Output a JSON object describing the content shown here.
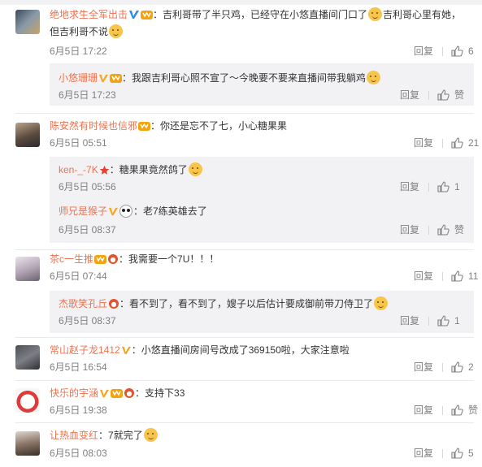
{
  "icons": {
    "like": "thumbs-up-icon",
    "verified": "verified-v-icon",
    "vip": "vip-crown-badge-icon",
    "star": "star-badge-icon",
    "emoji": "emoji-icon"
  },
  "colors": {
    "username": "#eb7350",
    "meta": "#808080",
    "subbox_bg": "#f2f2f5"
  },
  "comments": [
    {
      "user": "绝地求生全军出击",
      "text_line1": "：吉利哥带了半只鸡，已经守在小悠直播间门口了",
      "text_line1b": "吉利哥心里有她，",
      "text_line2": "但吉利哥不说",
      "date": "6月5日 17:22",
      "reply": "回复",
      "likes": "6",
      "subs": [
        {
          "user": "小悠珊珊",
          "text": "：我跟吉利哥心照不宣了～今晚要不要来直播间带我躺鸡",
          "date": "6月5日 17:23",
          "reply": "回复",
          "likes": "赞"
        }
      ]
    },
    {
      "user": "陈安然有时候也信邪",
      "text": "：你还是忘不了七，小心糖果果",
      "date": "6月5日 05:51",
      "reply": "回复",
      "likes": "21",
      "subs": [
        {
          "user": "ken-_-7K",
          "text": "：糖果果竟然鸽了",
          "date": "6月5日 05:56",
          "reply": "回复",
          "likes": "1"
        },
        {
          "user": "师兄是猴子",
          "text": "：老7练英雄去了",
          "date": "6月5日 08:37",
          "reply": "回复",
          "likes": "赞"
        }
      ]
    },
    {
      "user": "茶c一生推",
      "text": "：我需要一个7U！！！",
      "date": "6月5日 07:44",
      "reply": "回复",
      "likes": "11",
      "subs": [
        {
          "user": "杰歌笑孔丘",
          "text": "：看不到了，看不到了，嫂子以后估计要成御前带刀侍卫了",
          "date": "6月5日 08:37",
          "reply": "回复",
          "likes": "1"
        }
      ]
    },
    {
      "user": "常山赵子龙1412",
      "text": "：小悠直播间房间号改成了369150啦，大家注意啦",
      "date": "6月5日 16:54",
      "reply": "回复",
      "likes": "2"
    },
    {
      "user": "快乐的宇涵",
      "text": "：支持下33",
      "date": "6月5日 19:38",
      "reply": "回复",
      "likes": "赞"
    },
    {
      "user": "让热血变红",
      "text": "：7就完了",
      "date": "6月5日 08:03",
      "reply": "回复",
      "likes": "5"
    }
  ]
}
